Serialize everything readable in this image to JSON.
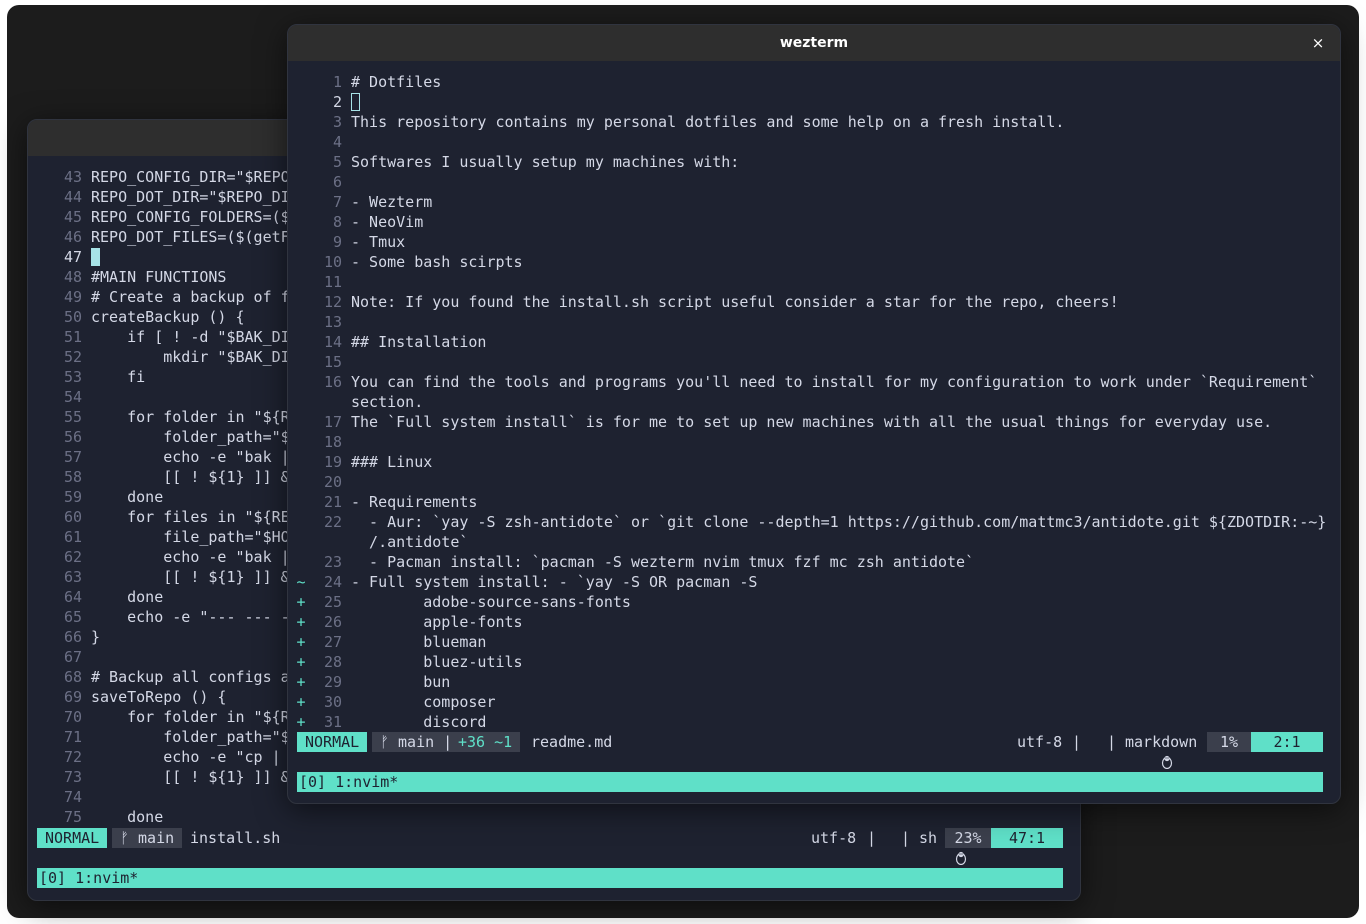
{
  "back_window": {
    "lines": [
      {
        "n": "43",
        "t": "REPO_CONFIG_DIR=\"$REPO"
      },
      {
        "n": "44",
        "t": "REPO_DOT_DIR=\"$REPO_DI"
      },
      {
        "n": "45",
        "t": "REPO_CONFIG_FOLDERS=($"
      },
      {
        "n": "46",
        "t": "REPO_DOT_FILES=($(getF"
      },
      {
        "n": "47",
        "t": ""
      },
      {
        "n": "48",
        "t": "#MAIN FUNCTIONS"
      },
      {
        "n": "49",
        "t": "# Create a backup of f"
      },
      {
        "n": "50",
        "t": "createBackup () {"
      },
      {
        "n": "51",
        "t": "    if [ ! -d \"$BAK_DI"
      },
      {
        "n": "52",
        "t": "        mkdir \"$BAK_DI"
      },
      {
        "n": "53",
        "t": "    fi"
      },
      {
        "n": "54",
        "t": ""
      },
      {
        "n": "55",
        "t": "    for folder in \"${R"
      },
      {
        "n": "56",
        "t": "        folder_path=\"$"
      },
      {
        "n": "57",
        "t": "        echo -e \"bak |"
      },
      {
        "n": "58",
        "t": "        [[ ! ${1} ]] &"
      },
      {
        "n": "59",
        "t": "    done"
      },
      {
        "n": "60",
        "t": "    for files in \"${RE"
      },
      {
        "n": "61",
        "t": "        file_path=\"$HO"
      },
      {
        "n": "62",
        "t": "        echo -e \"bak |"
      },
      {
        "n": "63",
        "t": "        [[ ! ${1} ]] &"
      },
      {
        "n": "64",
        "t": "    done"
      },
      {
        "n": "65",
        "t": "    echo -e \"--- --- -"
      },
      {
        "n": "66",
        "t": "}"
      },
      {
        "n": "67",
        "t": ""
      },
      {
        "n": "68",
        "t": "# Backup all configs a"
      },
      {
        "n": "69",
        "t": "saveToRepo () {"
      },
      {
        "n": "70",
        "t": "    for folder in \"${R"
      },
      {
        "n": "71",
        "t": "        folder_path=\"$"
      },
      {
        "n": "72",
        "t": "        echo -e \"cp |"
      },
      {
        "n": "73",
        "t": "        [[ ! ${1} ]] &"
      },
      {
        "n": "74",
        "t": ""
      },
      {
        "n": "75",
        "t": "    done"
      }
    ],
    "status": {
      "mode": "NORMAL",
      "branch": "ᚠ main",
      "file": "install.sh",
      "encoding": "utf-8",
      "sep1": "|",
      "sep2": "|",
      "filetype": "sh",
      "percent": "23%",
      "position": "47:1"
    },
    "tmux": "[0] 1:nvim*"
  },
  "front_window": {
    "title": "wezterm",
    "close": "×",
    "lines": [
      {
        "s": "",
        "n": "1",
        "t": "# Dotfiles"
      },
      {
        "s": "",
        "n": "2",
        "t": ""
      },
      {
        "s": "",
        "n": "3",
        "t": "This repository contains my personal dotfiles and some help on a fresh install."
      },
      {
        "s": "",
        "n": "4",
        "t": ""
      },
      {
        "s": "",
        "n": "5",
        "t": "Softwares I usually setup my machines with:"
      },
      {
        "s": "",
        "n": "6",
        "t": ""
      },
      {
        "s": "",
        "n": "7",
        "t": "- Wezterm"
      },
      {
        "s": "",
        "n": "8",
        "t": "- NeoVim"
      },
      {
        "s": "",
        "n": "9",
        "t": "- Tmux"
      },
      {
        "s": "",
        "n": "10",
        "t": "- Some bash scirpts"
      },
      {
        "s": "",
        "n": "11",
        "t": ""
      },
      {
        "s": "",
        "n": "12",
        "t": "Note: If you found the install.sh script useful consider a star for the repo, cheers!"
      },
      {
        "s": "",
        "n": "13",
        "t": ""
      },
      {
        "s": "",
        "n": "14",
        "t": "## Installation"
      },
      {
        "s": "",
        "n": "15",
        "t": ""
      },
      {
        "s": "",
        "n": "16",
        "t": "You can find the tools and programs you'll need to install for my configuration to work under `Requirement`"
      },
      {
        "s": "",
        "n": "",
        "t": "section."
      },
      {
        "s": "",
        "n": "17",
        "t": "The `Full system install` is for me to set up new machines with all the usual things for everyday use."
      },
      {
        "s": "",
        "n": "18",
        "t": ""
      },
      {
        "s": "",
        "n": "19",
        "t": "### Linux"
      },
      {
        "s": "",
        "n": "20",
        "t": ""
      },
      {
        "s": "",
        "n": "21",
        "t": "- Requirements"
      },
      {
        "s": "",
        "n": "22",
        "t": "  - Aur: `yay -S zsh-antidote` or `git clone --depth=1 https://github.com/mattmc3/antidote.git ${ZDOTDIR:-~}"
      },
      {
        "s": "",
        "n": "",
        "t": "  /.antidote`"
      },
      {
        "s": "",
        "n": "23",
        "t": "  - Pacman install: `pacman -S wezterm nvim tmux fzf mc zsh antidote`"
      },
      {
        "s": "~",
        "n": "24",
        "t": "- Full system install: - `yay -S OR pacman -S"
      },
      {
        "s": "+",
        "n": "25",
        "t": "        adobe-source-sans-fonts"
      },
      {
        "s": "+",
        "n": "26",
        "t": "        apple-fonts"
      },
      {
        "s": "+",
        "n": "27",
        "t": "        blueman"
      },
      {
        "s": "+",
        "n": "28",
        "t": "        bluez-utils"
      },
      {
        "s": "+",
        "n": "29",
        "t": "        bun"
      },
      {
        "s": "+",
        "n": "30",
        "t": "        composer"
      },
      {
        "s": "+",
        "n": "31",
        "t": "        discord"
      }
    ],
    "status": {
      "mode": "NORMAL",
      "branch": "ᚠ main |",
      "diff": "+36 ~1",
      "file": "readme.md",
      "encoding": "utf-8",
      "sep1": "|",
      "sep2": "|",
      "filetype": "markdown",
      "percent": "1%",
      "position": "2:1"
    },
    "tmux": "[0] 1:nvim*"
  },
  "colors": {
    "accent": "#5fe0c8",
    "background": "#1e2230",
    "titlebar": "#2e2e2e",
    "text": "#d4d8e6",
    "line_number": "#6c7086"
  }
}
